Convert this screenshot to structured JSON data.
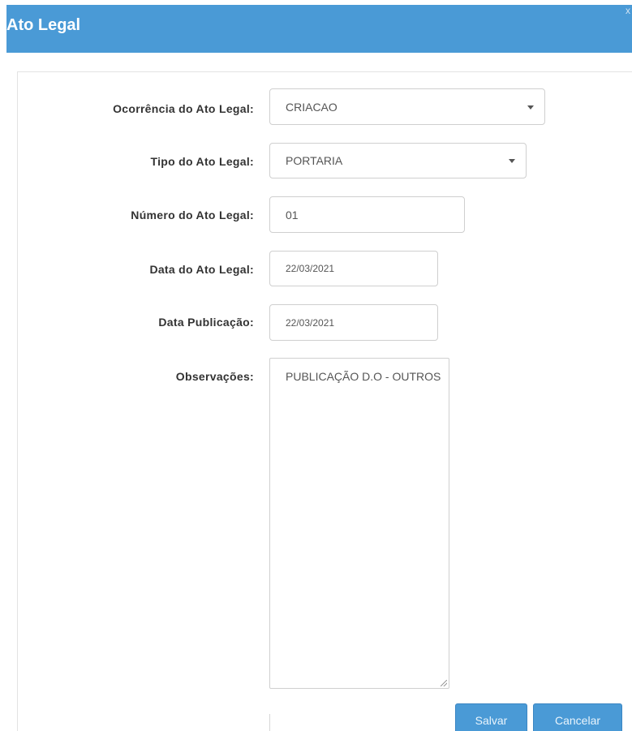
{
  "dialog": {
    "title": "Ato Legal",
    "close_glyph": "x"
  },
  "form": {
    "ocorrencia": {
      "label": "Ocorrência do Ato Legal:",
      "value": "CRIACAO"
    },
    "tipo": {
      "label": "Tipo do Ato Legal:",
      "value": "PORTARIA"
    },
    "numero": {
      "label": "Número do Ato Legal:",
      "value": "01"
    },
    "data_ato": {
      "label": "Data do Ato Legal:",
      "value": "22/03/2021"
    },
    "data_publicacao": {
      "label": "Data Publicação:",
      "value": "22/03/2021"
    },
    "observacoes": {
      "label": "Observações:",
      "value": "PUBLICAÇÃO D.O - OUTROS"
    }
  },
  "actions": {
    "save_label": "Salvar",
    "cancel_label": "Cancelar"
  },
  "colors": {
    "header_bg": "#4a9ad6",
    "button_bg": "#4a9ad6",
    "label_text": "#333333",
    "input_border": "#cfcfcf"
  },
  "icons": {
    "select_caret": "chevron-down-icon",
    "resize": "resize-handle-icon",
    "close": "close-icon"
  }
}
